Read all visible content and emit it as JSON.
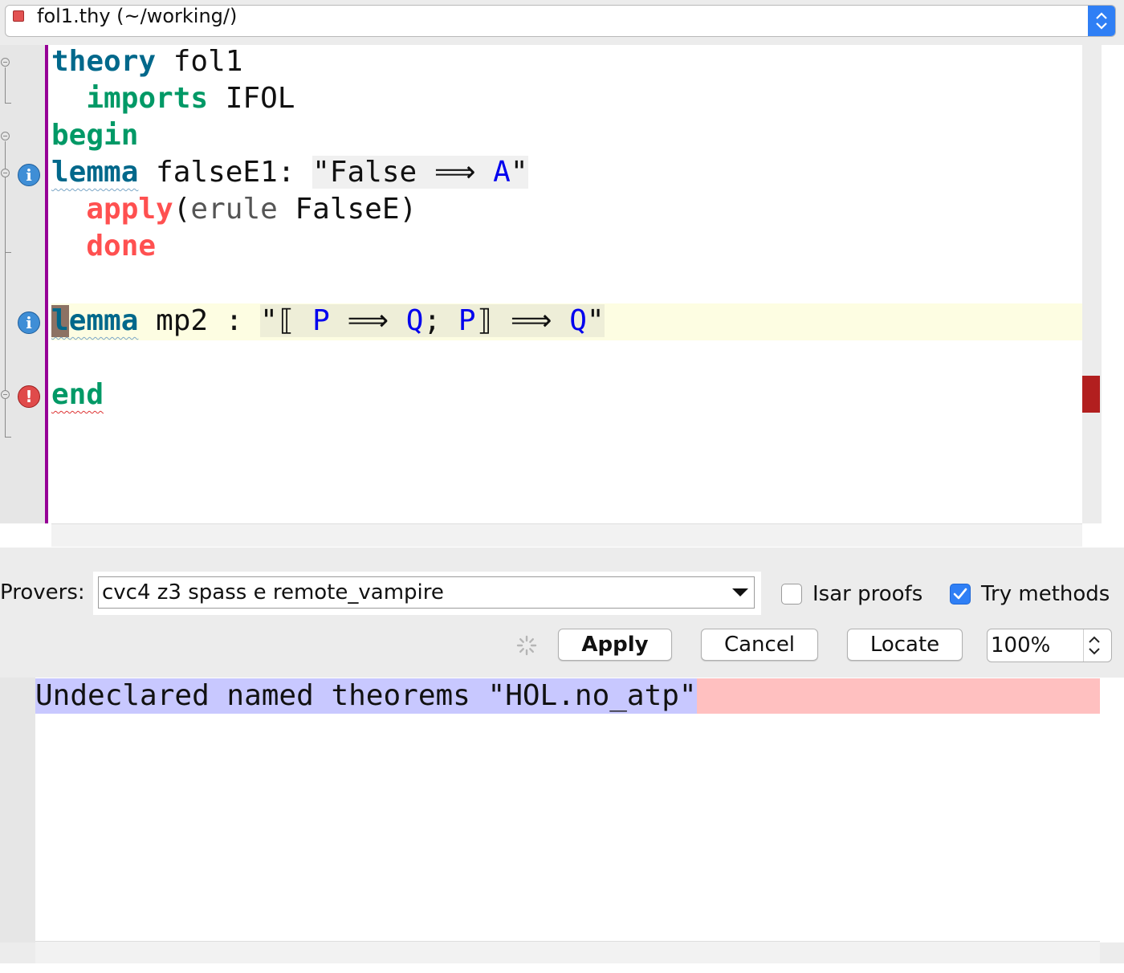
{
  "file_selector": {
    "label": "fol1.thy (~/working/)"
  },
  "editor": {
    "lines": [
      {
        "kw": "theory",
        "rest": " fol1"
      },
      {
        "kw": "imports",
        "rest": " IFOL"
      },
      {
        "kw": "begin"
      },
      {
        "kw": "lemma",
        "name": " falseE1: ",
        "prop_a": "\"False ",
        "arrow": "⟹",
        "prop_b": " A",
        "prop_c": "\""
      },
      {
        "kw": "apply",
        "paren": "(",
        "method": "erule",
        "rest": " FalseE)"
      },
      {
        "kw": "done"
      },
      {
        "caret": "l",
        "kw": "emma",
        "name": " mp2 : ",
        "p1": "\"⟦ ",
        "P": "P",
        "a1": " ⟹ ",
        "Q": "Q",
        "semi": "; ",
        "P2": "P",
        "close": "⟧",
        "a2": " ⟹ ",
        "Q2": "Q",
        "end": "\""
      },
      {
        "kw": "end"
      }
    ],
    "colors": {
      "theory": "#00688b",
      "begin": "#009966",
      "apply": "#ff5050",
      "free_var": "#0000ee",
      "error_marker": "#b21f1f"
    }
  },
  "sledgehammer": {
    "provers_label": "Provers:",
    "provers_value": "cvc4 z3 spass e remote_vampire",
    "isar_proofs_label": "Isar proofs",
    "isar_proofs_checked": false,
    "try_methods_label": "Try methods",
    "try_methods_checked": true,
    "apply_label": "Apply",
    "cancel_label": "Cancel",
    "locate_label": "Locate",
    "zoom_value": "100%"
  },
  "output": {
    "message": "Undeclared named theorems \"HOL.no_atp\""
  }
}
